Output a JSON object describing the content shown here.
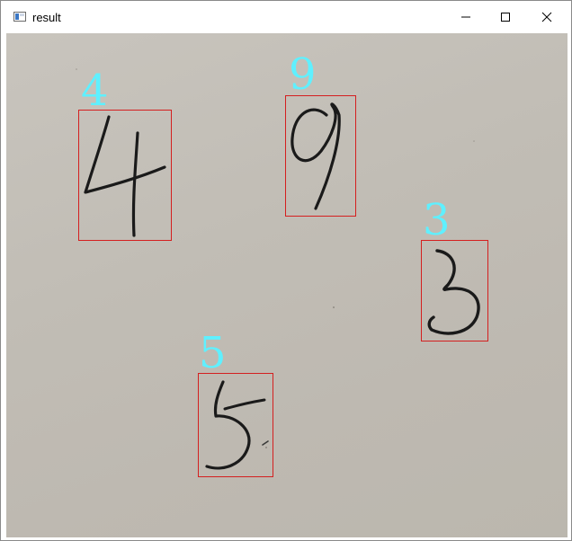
{
  "window": {
    "title": "result",
    "icons": {
      "app": "app-window-icon",
      "minimize": "minimize-icon",
      "maximize": "maximize-icon",
      "close": "close-icon"
    }
  },
  "detections": [
    {
      "label": "4",
      "id": "digit-4"
    },
    {
      "label": "9",
      "id": "digit-9"
    },
    {
      "label": "3",
      "id": "digit-3"
    },
    {
      "label": "5",
      "id": "digit-5"
    }
  ],
  "colors": {
    "box": "#d41f1f",
    "label": "#5ff0ff",
    "paper": "#c1bdb5",
    "ink": "#1a1a1a"
  }
}
